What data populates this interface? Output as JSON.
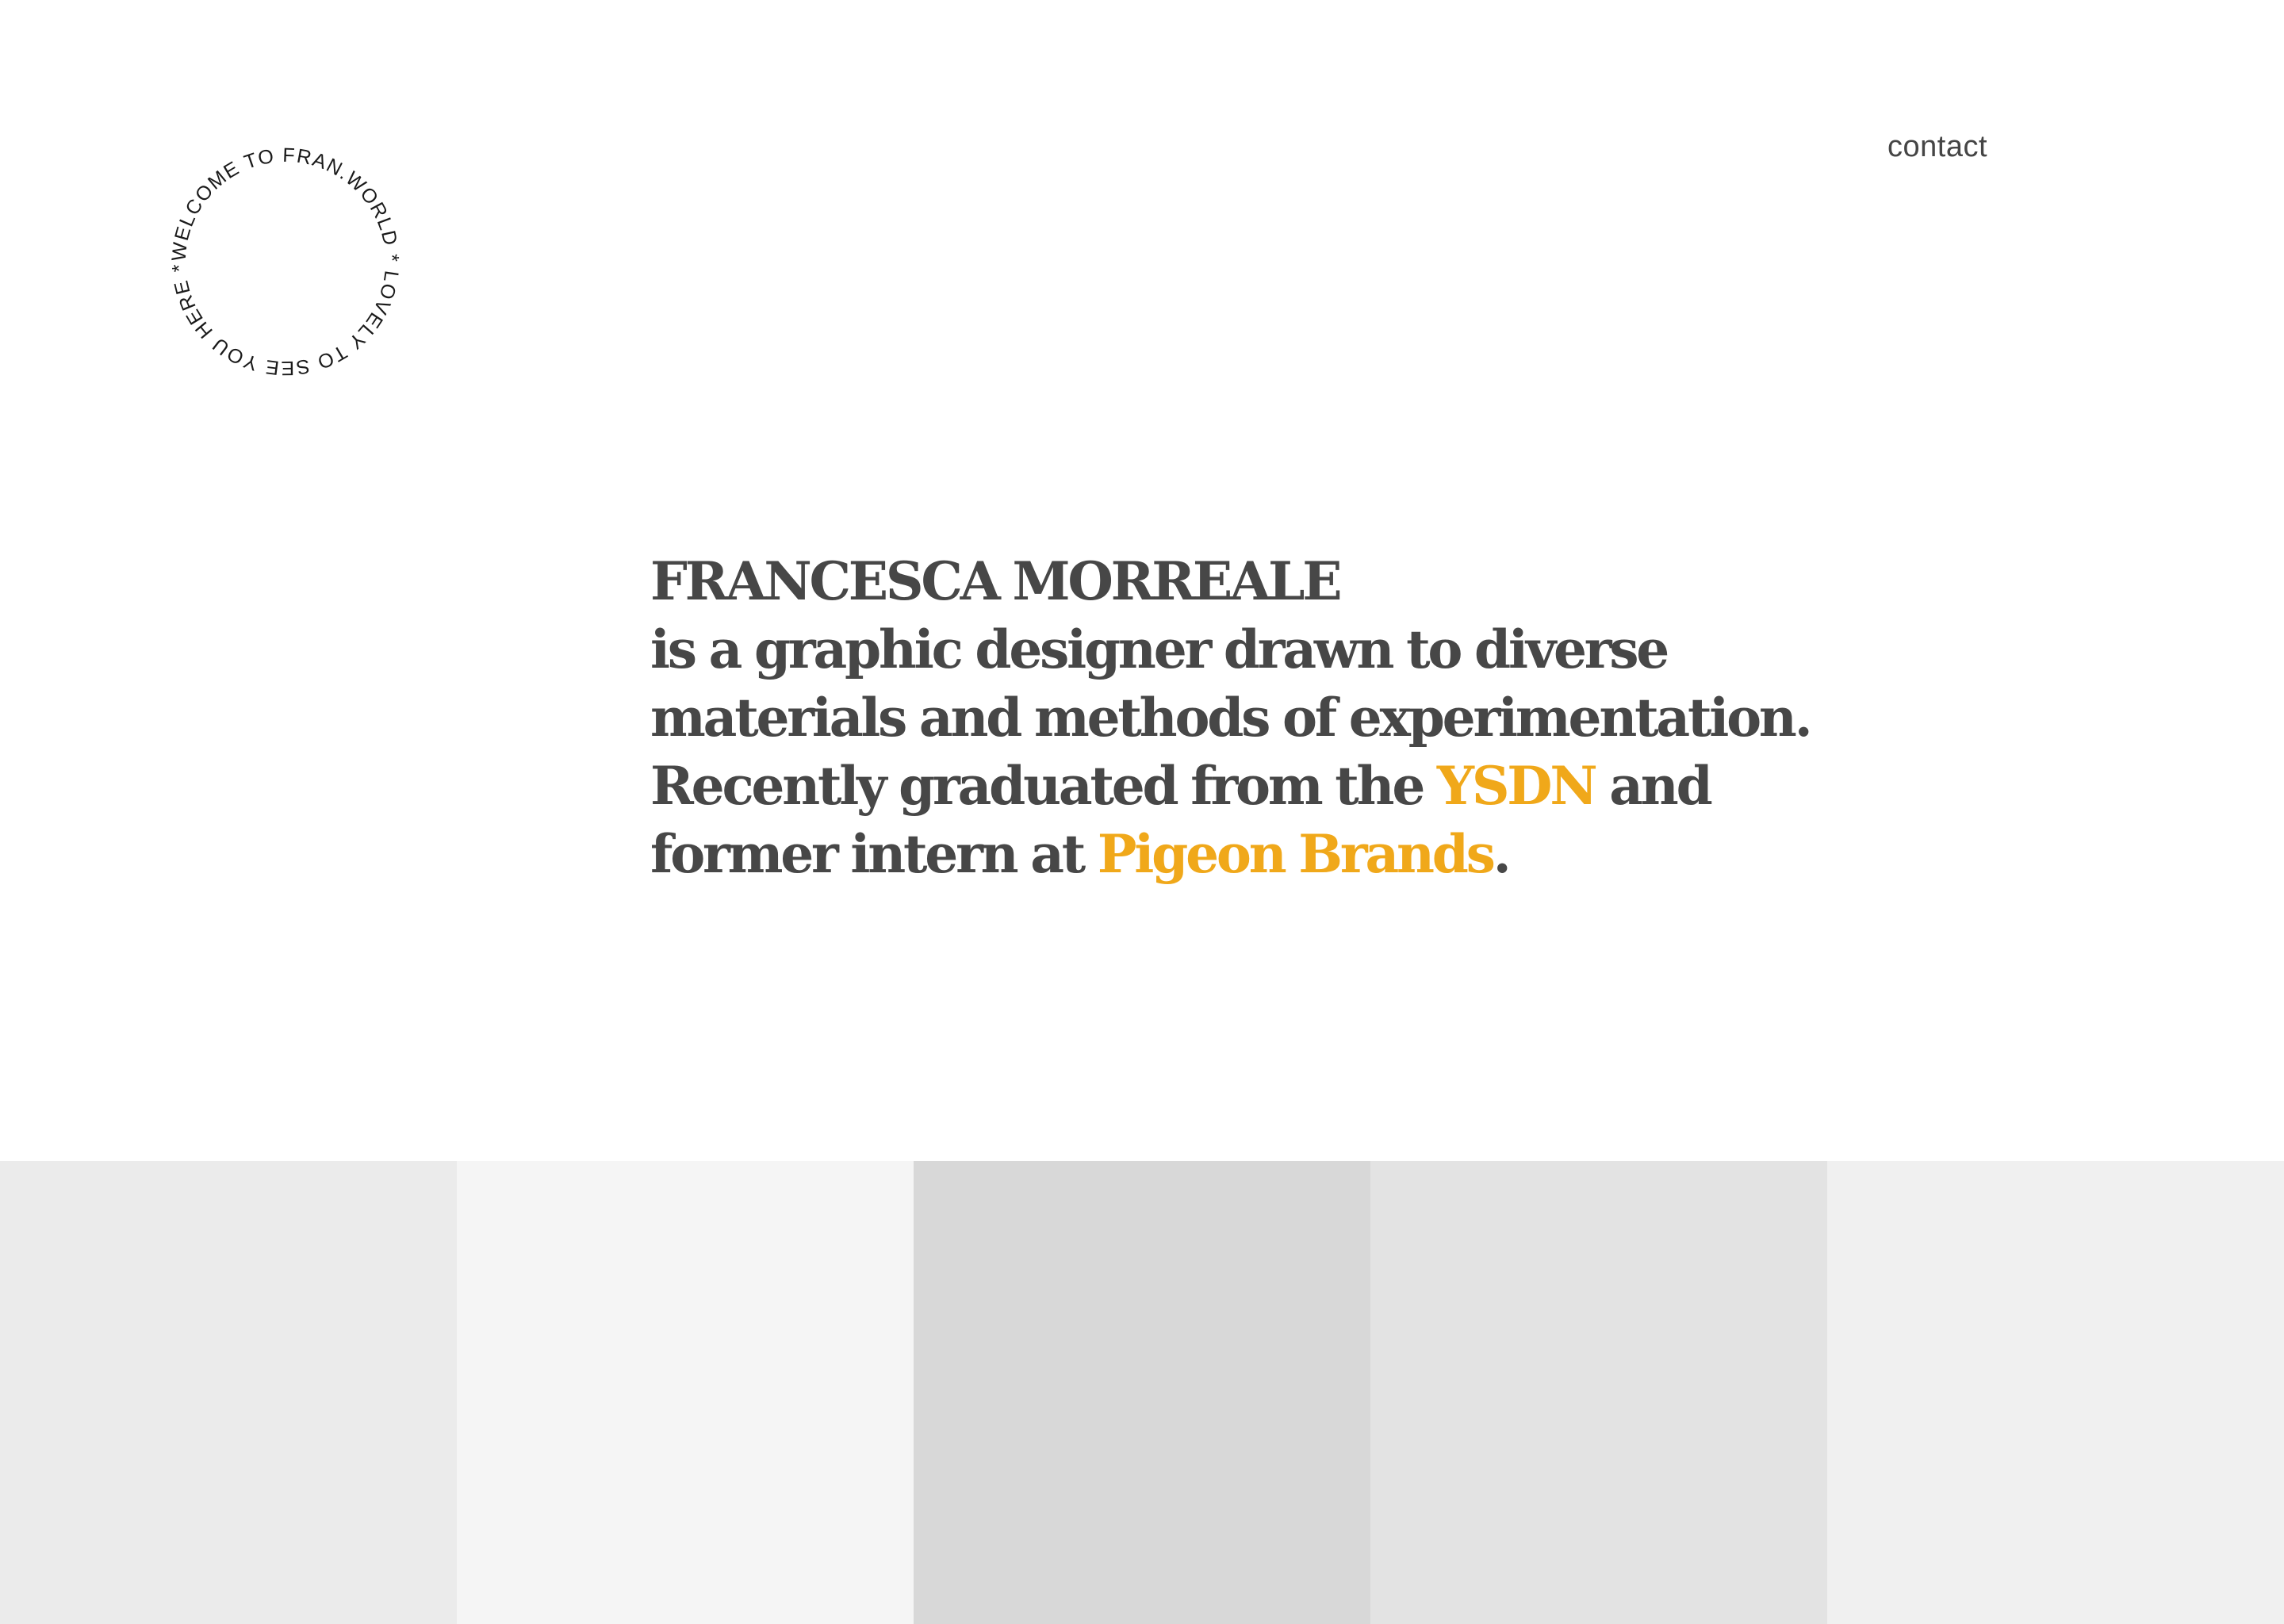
{
  "logo": {
    "ring_text": "WELCOME TO FRAN.WORLD * LOVELY TO SEE YOU HERE *",
    "ring_color": "#1a1a1a"
  },
  "nav": {
    "contact_label": "contact"
  },
  "intro": {
    "name": "FRANCESCA MORREALE",
    "line_2": "is a graphic designer drawn to diverse",
    "line_3": "materials and methods of experimentation.",
    "line_4_prefix": "Recently graduated from the ",
    "school_link": "YSDN",
    "line_4_suffix": " and",
    "line_5_prefix": "former intern at ",
    "employer_link": "Pigeon Brands",
    "line_5_suffix": ".",
    "text_color": "#474747",
    "accent_color": "#f0a81a"
  },
  "gallery": {
    "tiles": [
      {
        "color": "#ebebeb"
      },
      {
        "color": "#f5f5f5"
      },
      {
        "color": "#d8d8d8"
      },
      {
        "color": "#e3e3e3"
      },
      {
        "color": "#f0f0f0"
      }
    ]
  }
}
